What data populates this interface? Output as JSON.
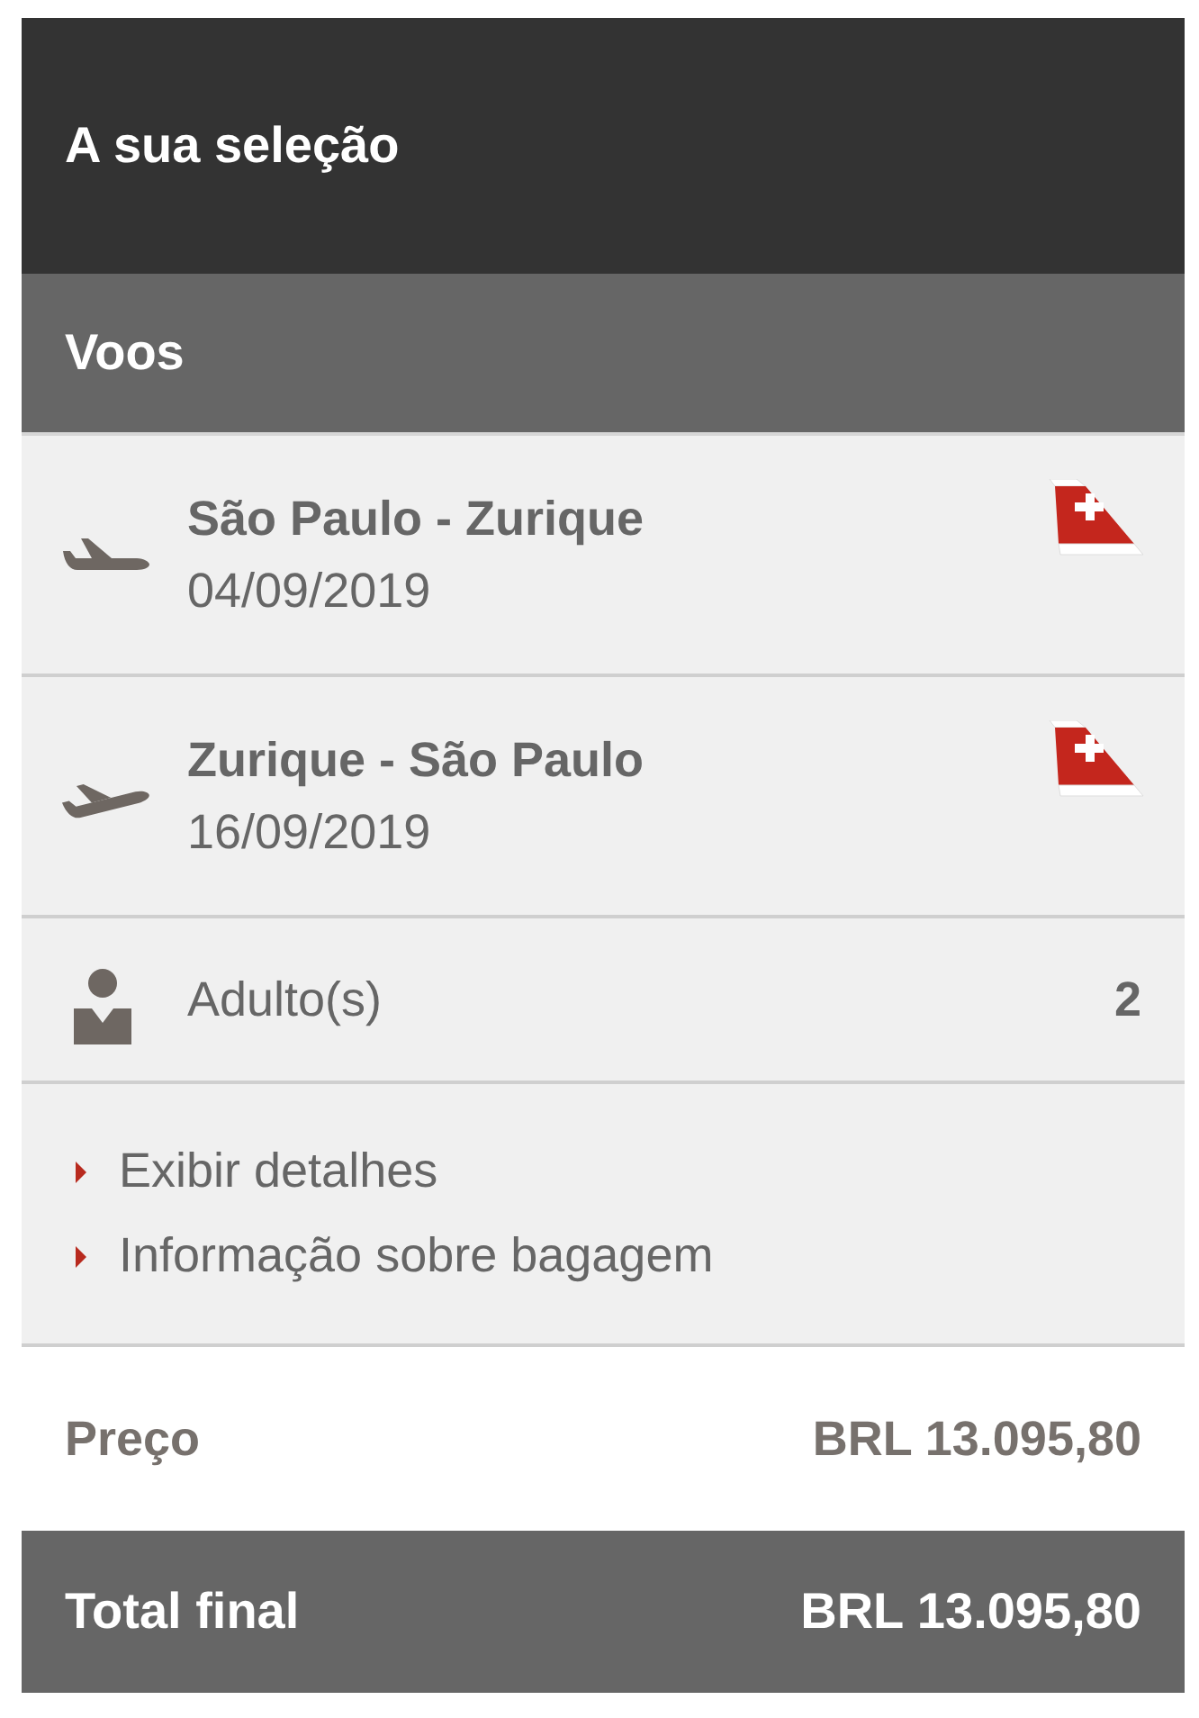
{
  "header": {
    "title": "A sua seleção"
  },
  "section": {
    "title": "Voos"
  },
  "flights": [
    {
      "kind": "level",
      "route": "São Paulo - Zurique",
      "date": "04/09/2019"
    },
    {
      "kind": "climb",
      "route": "Zurique - São Paulo",
      "date": "16/09/2019"
    }
  ],
  "passengers": {
    "label": "Adulto(s)",
    "count": "2"
  },
  "links": [
    "Exibir detalhes",
    "Informação sobre bagagem"
  ],
  "price": {
    "label": "Preço",
    "value": "BRL 13.095,80"
  },
  "total": {
    "label": "Total final",
    "value": "BRL 13.095,80"
  }
}
